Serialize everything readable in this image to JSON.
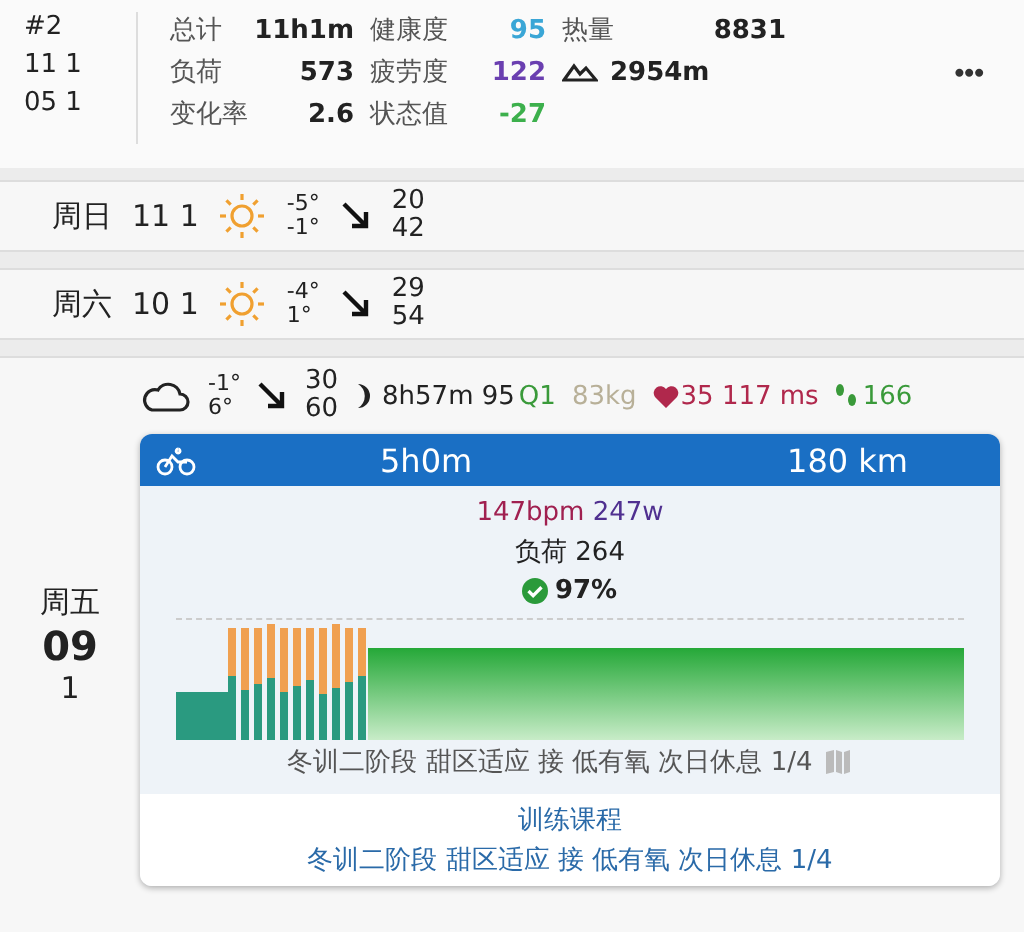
{
  "summary": {
    "rank": "#2",
    "line_2": "11 1",
    "line_3": "05 1",
    "stats": [
      {
        "kind": "labeled",
        "label": "总计",
        "value": "11h1m"
      },
      {
        "kind": "labeled",
        "label": "健康度",
        "value": "95",
        "color": "#3aa6d6"
      },
      {
        "kind": "labeled",
        "label": "热量",
        "value": "8831"
      },
      {
        "kind": "labeled",
        "label": "负荷",
        "value": "573"
      },
      {
        "kind": "labeled",
        "label": "疲劳度",
        "value": "122",
        "color": "#6a3fb0"
      },
      {
        "kind": "elevation",
        "value": "2954m"
      },
      {
        "kind": "labeled",
        "label": "变化率",
        "value": "2.6"
      },
      {
        "kind": "labeled",
        "label": "状态值",
        "value": "-27",
        "color": "#3cb04c"
      }
    ],
    "menu": "•••"
  },
  "days": [
    {
      "weekday": "周日",
      "date": "11 1",
      "weather": {
        "kind": "sunny"
      },
      "low": "-5°",
      "high": "-1°",
      "wind_1": "20",
      "wind_2": "42"
    },
    {
      "weekday": "周六",
      "date": "10 1",
      "weather": {
        "kind": "sunny"
      },
      "low": "-4°",
      "high": "1°",
      "wind_1": "29",
      "wind_2": "54"
    }
  ],
  "today": {
    "weekday": "周五",
    "day": "09",
    "month": "1",
    "weather": {
      "kind": "cloudy"
    },
    "low": "-1°",
    "high": "6°",
    "wind_1": "30",
    "wind_2": "60",
    "sleep": "8h57m",
    "sleep_score": "95",
    "quality": "Q1",
    "weight": "83kg",
    "resting_hr": "35",
    "hrv": "117 ms",
    "steps": "166",
    "workout": {
      "sport": {
        "kind": "cycling"
      },
      "duration": "5h0m",
      "distance": "180 km",
      "heart_rate": "147bpm",
      "power": "247w",
      "load": "负荷 264",
      "completion": "97%",
      "description": "冬训二阶段 甜区适应 接 低有氧 次日休息 1/4",
      "course_title": "训练课程",
      "course_name": "冬训二阶段 甜区适应 接 低有氧 次日休息 1/4"
    }
  }
}
